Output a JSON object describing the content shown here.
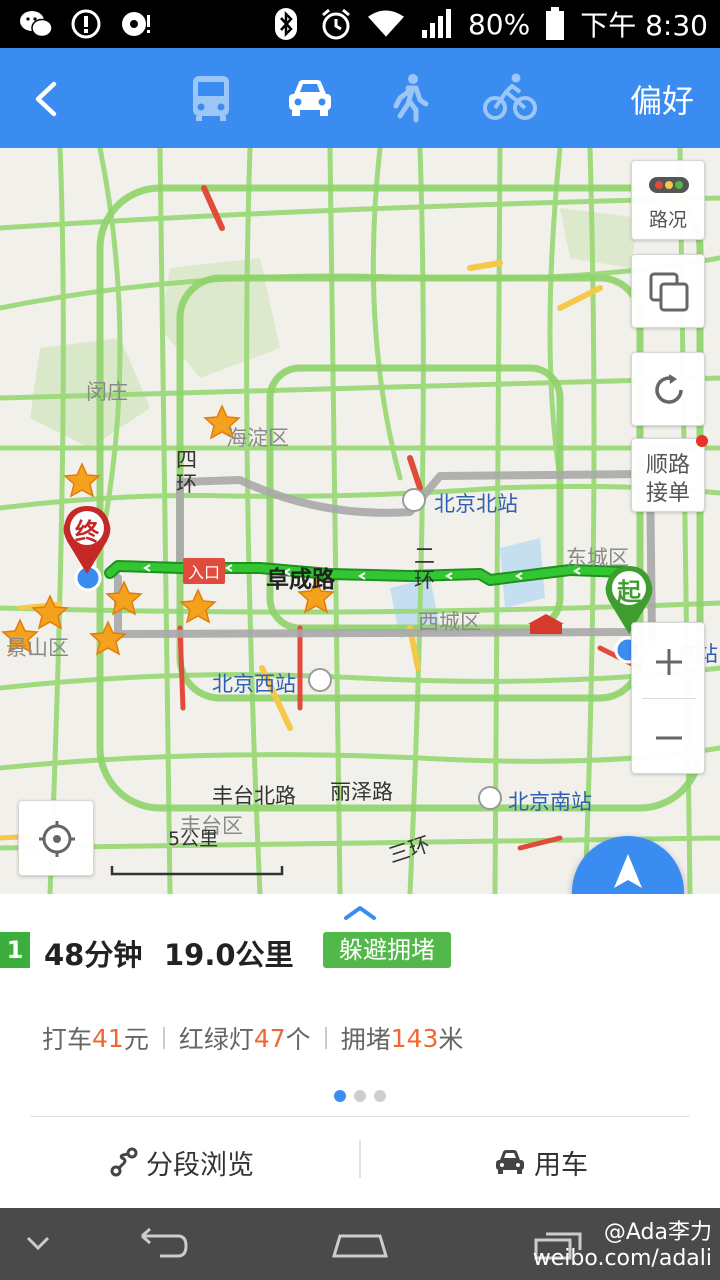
{
  "status_bar": {
    "battery": "80%",
    "time": "下午 8:30"
  },
  "header": {
    "back_icon": "back-chevron-icon",
    "modes": [
      {
        "name": "bus",
        "icon": "bus-icon",
        "selected": false
      },
      {
        "name": "car",
        "icon": "car-icon",
        "selected": true
      },
      {
        "name": "walk",
        "icon": "walk-icon",
        "selected": false
      },
      {
        "name": "bike",
        "icon": "bike-icon",
        "selected": false
      }
    ],
    "preference": "偏好"
  },
  "map": {
    "labels": {
      "minzhuang": "闵庄",
      "haidian": "海淀区",
      "ring4_a": "四",
      "ring4_b": "环",
      "beijing_north": "北京北站",
      "dongcheng": "东城区",
      "fuchenglu": "阜成路",
      "ring2_a": "二",
      "ring2_b": "环",
      "xicheng": "西城区",
      "shijingshan": "景山区",
      "beijing_west": "北京西站",
      "beijing_station_partial": "京站",
      "fengtai_north": "丰台北路",
      "lize": "丽泽路",
      "beijing_south": "北京南站",
      "fengtai": "丰台区",
      "ring3": "三环",
      "entrance": "入口",
      "end_marker": "终",
      "start_marker": "起"
    },
    "traffic_button": "路况",
    "carpool_button_line1": "顺路",
    "carpool_button_line2": "接单",
    "scale": "5公里",
    "navigate_button": "导航",
    "colors": {
      "route": "#2fbf2f",
      "road_green": "#8fd36a",
      "road_yellow": "#f5c84a",
      "road_red": "#e24b3b",
      "end_marker": "#c62828",
      "start_marker": "#3f9d2f"
    }
  },
  "route": {
    "index": "1",
    "duration": "48分钟",
    "distance": "19.0公里",
    "tag": "躲避拥堵",
    "taxi_label": "打车",
    "taxi_value": "41",
    "taxi_unit": "元",
    "lights_label": "红绿灯",
    "lights_value": "47",
    "lights_unit": "个",
    "jam_label": "拥堵",
    "jam_value": "143",
    "jam_unit": "米",
    "page_count": 3,
    "page_active": 1
  },
  "actions": {
    "segments": "分段浏览",
    "car_service": "用车"
  },
  "watermark": {
    "line1": "@Ada李力",
    "line2": "weibo.com/adali"
  }
}
